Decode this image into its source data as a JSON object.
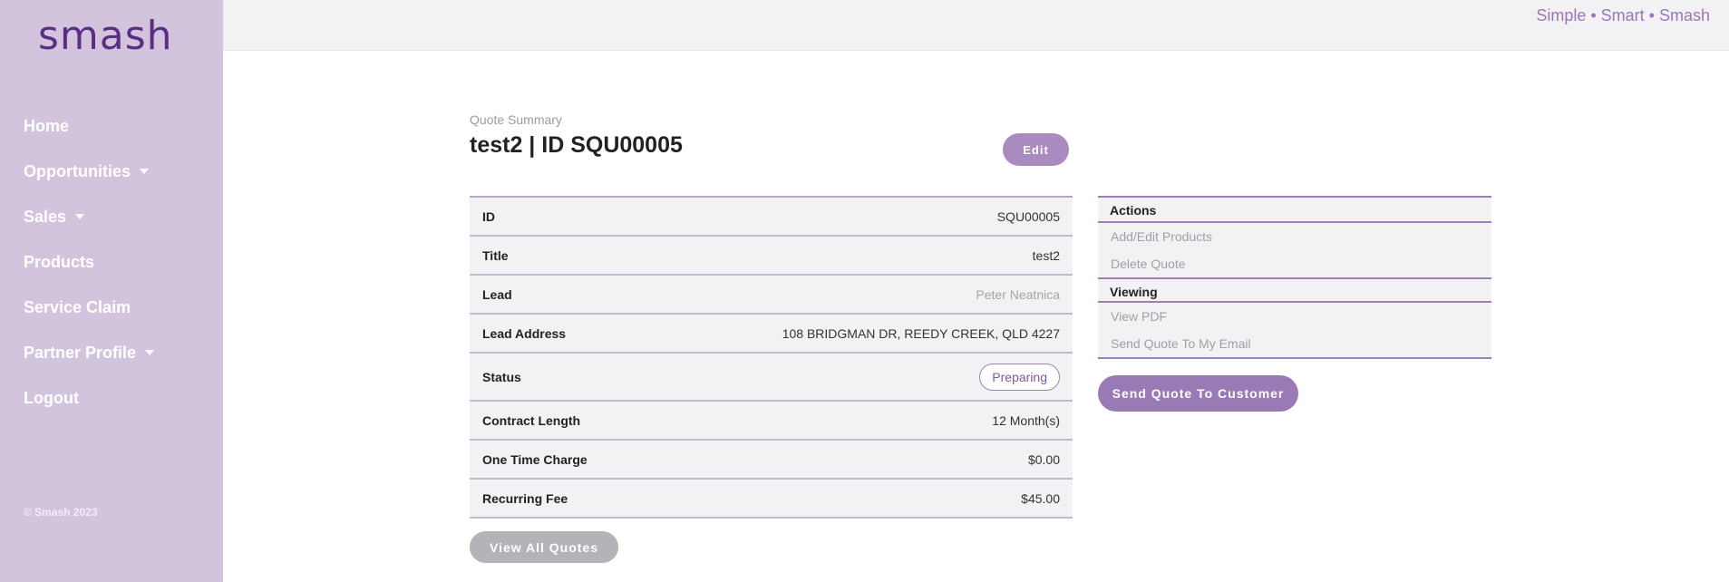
{
  "sidebar": {
    "logo": "smash",
    "items": [
      {
        "label": "Home"
      },
      {
        "label": "Opportunities"
      },
      {
        "label": "Sales"
      },
      {
        "label": "Products"
      },
      {
        "label": "Service Claim"
      },
      {
        "label": "Partner Profile"
      },
      {
        "label": "Logout"
      }
    ],
    "copyright": "© Smash 2023"
  },
  "topbar": {
    "tagline": "Simple • Smart • Smash"
  },
  "main": {
    "summary_label": "Quote Summary",
    "title": "test2 | ID SQU00005",
    "edit_label": "Edit",
    "details": [
      {
        "key": "ID",
        "value": "SQU00005"
      },
      {
        "key": "Title",
        "value": "test2"
      },
      {
        "key": "Lead",
        "value": "Peter Neatnica"
      },
      {
        "key": "Lead Address",
        "value": "108 BRIDGMAN DR, REEDY CREEK, QLD 4227"
      },
      {
        "key": "Status",
        "value": "Preparing"
      },
      {
        "key": "Contract Length",
        "value": "12 Month(s)"
      },
      {
        "key": "One Time Charge",
        "value": "$0.00"
      },
      {
        "key": "Recurring Fee",
        "value": "$45.00"
      }
    ],
    "view_all_label": "View All Quotes"
  },
  "actions_panel": {
    "actions_title": "Actions",
    "add_edit_products": "Add/Edit Products",
    "delete_quote": "Delete Quote",
    "viewing_title": "Viewing",
    "view_pdf": "View PDF",
    "send_to_email": "Send Quote To My Email",
    "send_to_customer": "Send Quote To Customer"
  },
  "colors": {
    "sidebar_bg": "#d3c4de",
    "brand_purple": "#5b2e84",
    "accent": "#9a7ab5",
    "muted_button": "#b5b3b7"
  },
  "icons": [
    "chevron-down-icon"
  ]
}
